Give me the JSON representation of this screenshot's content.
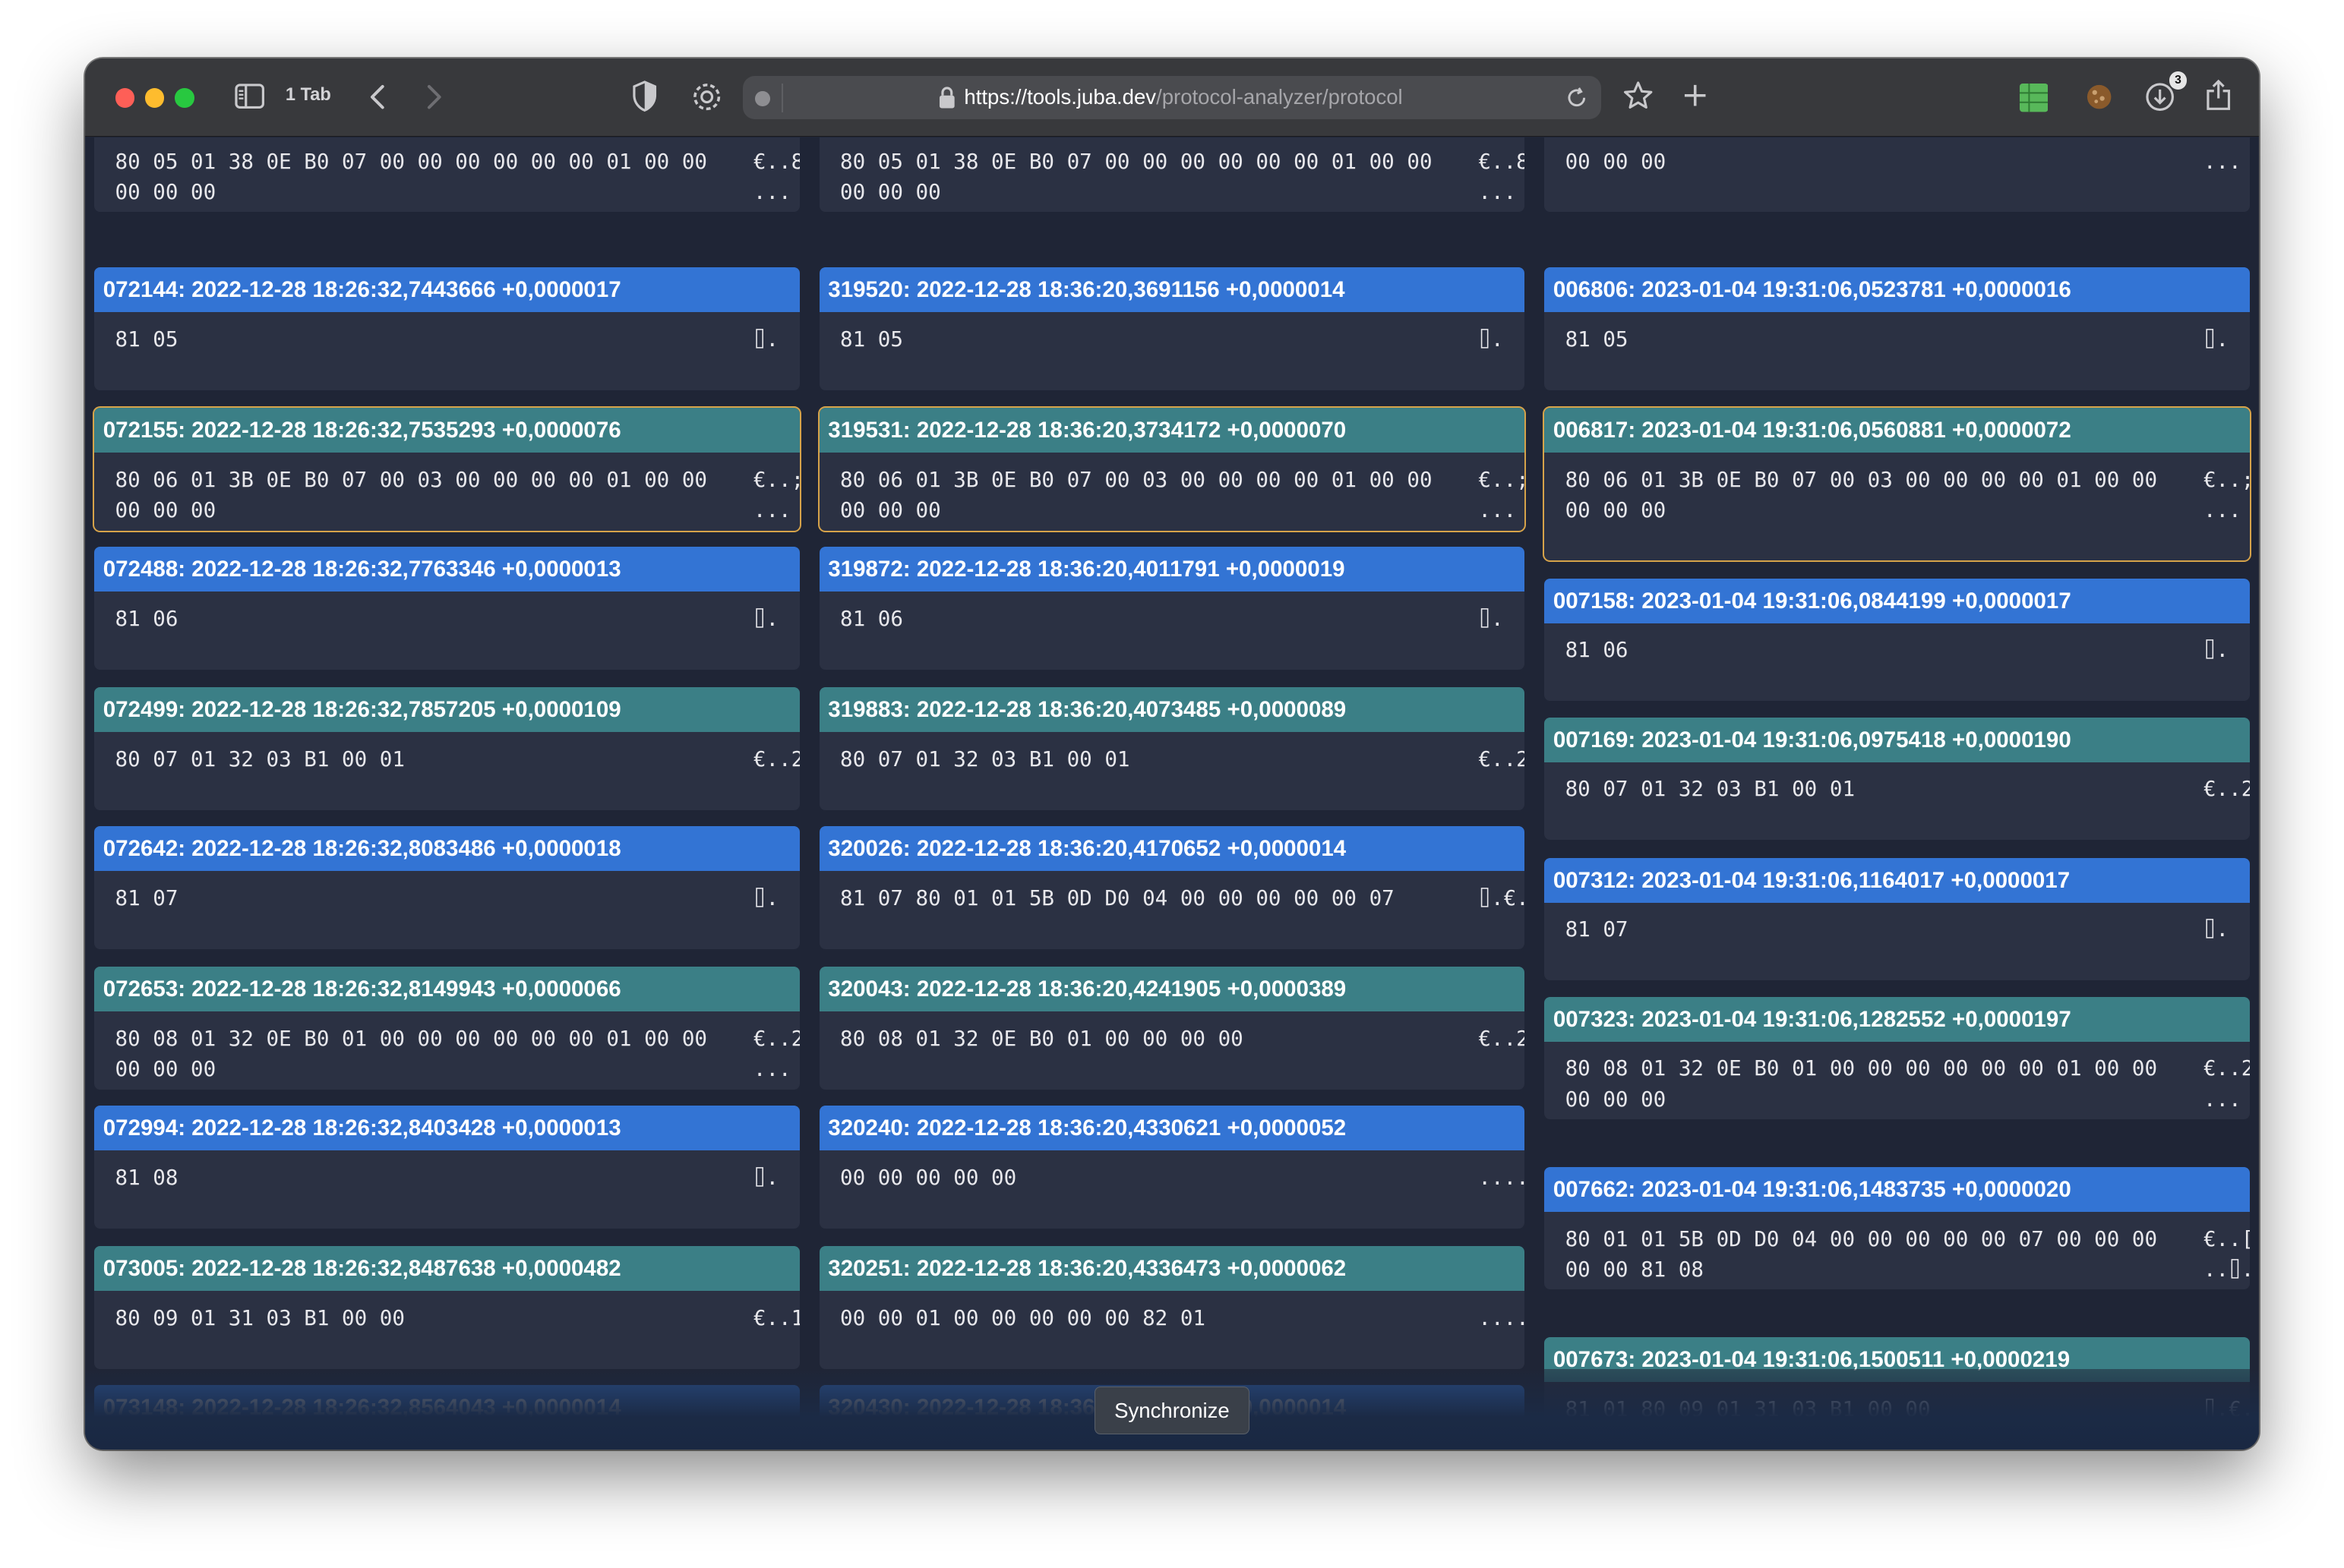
{
  "browser": {
    "tab_count": "1 Tab",
    "url_domain": "https://tools.juba.dev",
    "url_path": "/protocol-analyzer/protocol",
    "downloads_badge": "3"
  },
  "columns": [
    {
      "cards": [
        {
          "type": "partial",
          "hex": "80 05 01 38 0E B0 07 00 00 00 00 00 00 01 00 00 00 00 00",
          "ascii": "€..8 ..."
        },
        {
          "type": "response",
          "header": "072144: 2022-12-28 18:26:32,7443666 +0,0000017",
          "hex": "81 05",
          "ascii": "⌷."
        },
        {
          "type": "request",
          "header": "072155: 2022-12-28 18:26:32,7535293 +0,0000076",
          "hex": "80 06 01 3B 0E B0 07 00 03 00 00 00 00 01 00 00 00 00 00",
          "ascii": "€..; ...",
          "selected": true
        },
        {
          "type": "response",
          "header": "072488: 2022-12-28 18:26:32,7763346 +0,0000013",
          "hex": "81 06",
          "ascii": "⌷."
        },
        {
          "type": "request",
          "header": "072499: 2022-12-28 18:26:32,7857205 +0,0000109",
          "hex": "80 07 01 32 03 B1 00 01",
          "ascii": "€..2"
        },
        {
          "type": "response",
          "header": "072642: 2022-12-28 18:26:32,8083486 +0,0000018",
          "hex": "81 07",
          "ascii": "⌷."
        },
        {
          "type": "request",
          "header": "072653: 2022-12-28 18:26:32,8149943 +0,0000066",
          "hex": "80 08 01 32 0E B0 01 00 00 00 00 00 00 01 00 00 00 00 00",
          "ascii": "€..2 ..."
        },
        {
          "type": "response",
          "header": "072994: 2022-12-28 18:26:32,8403428 +0,0000013",
          "hex": "81 08",
          "ascii": "⌷."
        },
        {
          "type": "request",
          "header": "073005: 2022-12-28 18:26:32,8487638 +0,0000482",
          "hex": "80 09 01 31 03 B1 00 00",
          "ascii": "€..1"
        },
        {
          "type": "response",
          "header": "073148: 2022-12-28 18:26:32,8564043 +0,0000014",
          "hex": "",
          "ascii": ""
        }
      ]
    },
    {
      "cards": [
        {
          "type": "partial",
          "hex": "80 05 01 38 0E B0 07 00 00 00 00 00 00 01 00 00 00 00 00",
          "ascii": "€..8 ..."
        },
        {
          "type": "response",
          "header": "319520: 2022-12-28 18:36:20,3691156 +0,0000014",
          "hex": "81 05",
          "ascii": "⌷."
        },
        {
          "type": "request",
          "header": "319531: 2022-12-28 18:36:20,3734172 +0,0000070",
          "hex": "80 06 01 3B 0E B0 07 00 03 00 00 00 00 01 00 00 00 00 00",
          "ascii": "€..; ...",
          "selected": true
        },
        {
          "type": "response",
          "header": "319872: 2022-12-28 18:36:20,4011791 +0,0000019",
          "hex": "81 06",
          "ascii": "⌷."
        },
        {
          "type": "request",
          "header": "319883: 2022-12-28 18:36:20,4073485 +0,0000089",
          "hex": "80 07 01 32 03 B1 00 01",
          "ascii": "€..2"
        },
        {
          "type": "response",
          "header": "320026: 2022-12-28 18:36:20,4170652 +0,0000014",
          "hex": "81 07 80 01 01 5B 0D D0 04 00 00 00 00 00 07",
          "ascii": "⌷.€."
        },
        {
          "type": "request",
          "header": "320043: 2022-12-28 18:36:20,4241905 +0,0000389",
          "hex": "80 08 01 32 0E B0 01 00 00 00 00",
          "ascii": "€..2"
        },
        {
          "type": "response",
          "header": "320240: 2022-12-28 18:36:20,4330621 +0,0000052",
          "hex": "00 00 00 00 00",
          "ascii": "....."
        },
        {
          "type": "request",
          "header": "320251: 2022-12-28 18:36:20,4336473 +0,0000062",
          "hex": "00 00 01 00 00 00 00 00 82 01",
          "ascii": "....."
        },
        {
          "type": "response",
          "header": "320430: 2022-12-28 18:36:20,4401043 +0,0000014",
          "hex": "",
          "ascii": ""
        }
      ]
    },
    {
      "cards": [
        {
          "type": "partial",
          "hex": "00 00 00",
          "ascii": "..."
        },
        {
          "type": "response",
          "header": "006806: 2023-01-04 19:31:06,0523781 +0,0000016",
          "hex": "81 05",
          "ascii": "⌷."
        },
        {
          "type": "request",
          "header": "006817: 2023-01-04 19:31:06,0560881 +0,0000072",
          "hex": "80 06 01 3B 0E B0 07 00 03 00 00 00 00 01 00 00 00 00 00",
          "ascii": "€..; ...",
          "selected": true
        },
        {
          "type": "response",
          "header": "007158: 2023-01-04 19:31:06,0844199 +0,0000017",
          "hex": "81 06",
          "ascii": "⌷."
        },
        {
          "type": "request",
          "header": "007169: 2023-01-04 19:31:06,0975418 +0,0000190",
          "hex": "80 07 01 32 03 B1 00 01",
          "ascii": "€..2"
        },
        {
          "type": "response",
          "header": "007312: 2023-01-04 19:31:06,1164017 +0,0000017",
          "hex": "81 07",
          "ascii": "⌷."
        },
        {
          "type": "request",
          "header": "007323: 2023-01-04 19:31:06,1282552 +0,0000197",
          "hex": "80 08 01 32 0E B0 01 00 00 00 00 00 00 01 00 00 00 00 00",
          "ascii": "€..2 ..."
        },
        {
          "type": "response",
          "header": "007662: 2023-01-04 19:31:06,1483735 +0,0000020",
          "hex": "80 01 01 5B 0D D0 04 00 00 00 00 00 07 00 00 00 00 00 81 08",
          "ascii": "€..[ ..⌷."
        },
        {
          "type": "request",
          "header": "007673: 2023-01-04 19:31:06,1500511 +0,0000219",
          "hex": "81 01 80 09 01 31 03 B1 00 00",
          "ascii": "⌷.€."
        }
      ]
    }
  ],
  "footer": {
    "sync_label": "Synchronize"
  }
}
